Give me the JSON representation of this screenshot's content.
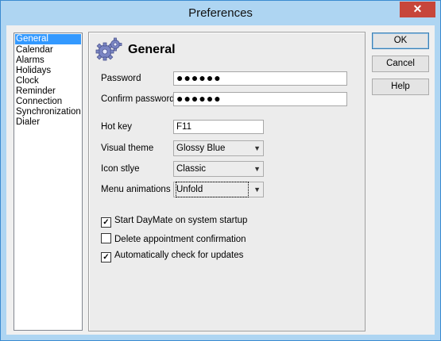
{
  "window": {
    "title": "Preferences",
    "close_glyph": "✕"
  },
  "sidebar": {
    "items": [
      {
        "label": "General",
        "selected": true
      },
      {
        "label": "Calendar"
      },
      {
        "label": "Alarms"
      },
      {
        "label": "Holidays"
      },
      {
        "label": "Clock"
      },
      {
        "label": "Reminder"
      },
      {
        "label": "Connection"
      },
      {
        "label": "Synchronization"
      },
      {
        "label": "Dialer"
      }
    ]
  },
  "panel": {
    "heading": "General",
    "icon": "gears-icon",
    "password": {
      "label": "Password",
      "value": "●●●●●●"
    },
    "confirm_password": {
      "label": "Confirm password",
      "value": "●●●●●●"
    },
    "hot_key": {
      "label": "Hot key",
      "value": "F11"
    },
    "visual_theme": {
      "label": "Visual theme",
      "value": "Glossy Blue"
    },
    "icon_style": {
      "label": "Icon stlye",
      "value": "Classic"
    },
    "menu_animations": {
      "label": "Menu animations",
      "value": "Unfold"
    },
    "checkboxes": [
      {
        "label": "Start DayMate on system startup",
        "checked": true
      },
      {
        "label": "Delete appointment confirmation",
        "checked": false
      },
      {
        "label": "Automatically check for updates",
        "checked": true
      }
    ]
  },
  "buttons": {
    "ok": "OK",
    "cancel": "Cancel",
    "help": "Help"
  },
  "colors": {
    "titlebar": "#aed5f2",
    "close": "#c7463a",
    "selection": "#3399ff"
  }
}
